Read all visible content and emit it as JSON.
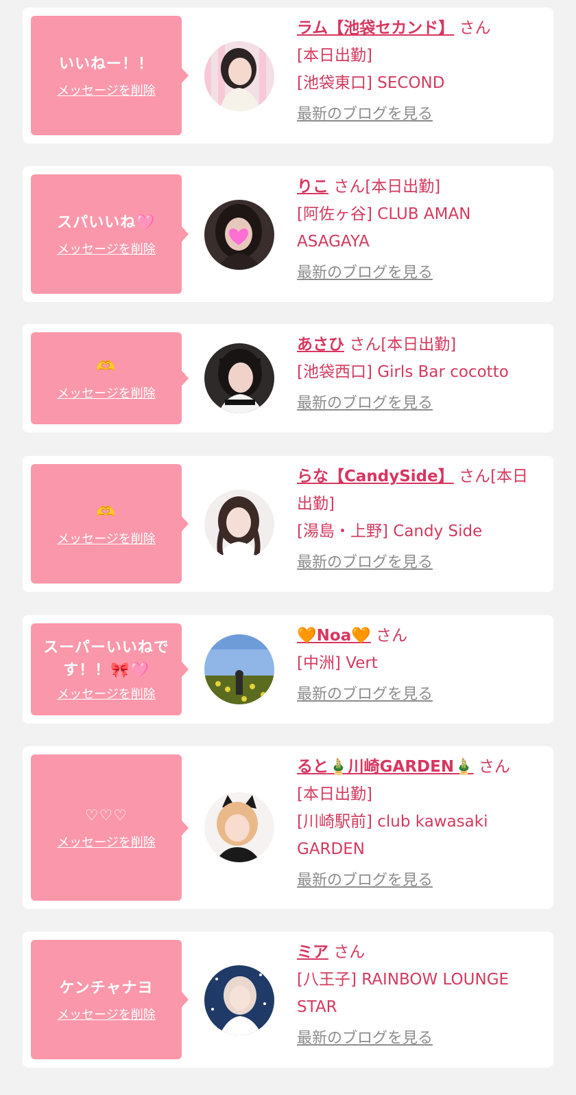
{
  "delete_label": "メッセージを削除",
  "blog_label": "最新のブログを見る",
  "items": [
    {
      "message": "いいねー！！",
      "cast_name": "ラム【池袋セカンド】",
      "honorific": "さん",
      "status": "[本日出勤]",
      "shop": "[池袋東口] SECOND",
      "avatar_icon": "avatar-ram-photo"
    },
    {
      "message": "スパいいね🩷",
      "cast_name": "りこ",
      "honorific": "さん",
      "status": "[本日出勤]",
      "shop": "[阿佐ヶ谷] CLUB AMAN ASAGAYA",
      "avatar_icon": "avatar-riko-photo"
    },
    {
      "message": "🫶",
      "cast_name": "あさひ",
      "honorific": "さん",
      "status": "[本日出勤]",
      "shop": "[池袋西口] Girls Bar cocotto",
      "avatar_icon": "avatar-asahi-photo"
    },
    {
      "message": "🫶",
      "cast_name": "らな【CandySide】",
      "honorific": "さん",
      "status": "[本日出勤]",
      "shop": "[湯島・上野] Candy Side",
      "avatar_icon": "avatar-rana-photo"
    },
    {
      "message": "スーパーいいねです！！🎀🩷",
      "cast_name": "🧡Noa🧡",
      "honorific": "さん",
      "status": "",
      "shop": "[中洲] Vert",
      "avatar_icon": "avatar-noa-photo"
    },
    {
      "message": "♡♡♡",
      "cast_name": "ると🎍川崎GARDEN🎍",
      "honorific": "さん",
      "status": "[本日出勤]",
      "shop": "[川崎駅前] club kawasaki GARDEN",
      "avatar_icon": "avatar-ruto-photo"
    },
    {
      "message": "ケンチャナヨ",
      "cast_name": "ミア",
      "honorific": "さん",
      "status": "",
      "shop": "[八王子] RAINBOW LOUNGE STAR",
      "avatar_icon": "avatar-mia-photo"
    }
  ],
  "colors": {
    "bubble": "#fb97aa",
    "name": "#d7365f",
    "text": "#d23a5e",
    "blog_link": "#8c8c8c",
    "page_bg": "#f2f2f2"
  }
}
